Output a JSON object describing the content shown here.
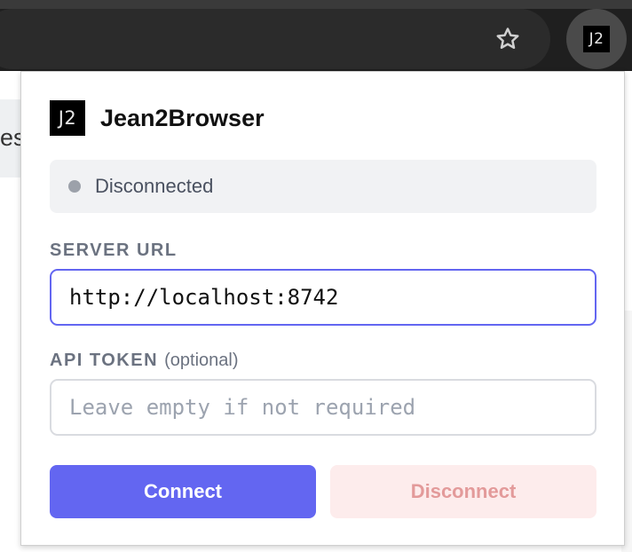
{
  "browser": {
    "star_icon": "star-outline-icon",
    "extension_badge": "J2"
  },
  "page_behind": {
    "left_text": "es"
  },
  "popup": {
    "logo_text": "J2",
    "title": "Jean2Browser",
    "status": {
      "text": "Disconnected",
      "dot_color": "#9ca1aa"
    },
    "server_url": {
      "label": "SERVER URL",
      "value": "http://localhost:8742"
    },
    "api_token": {
      "label": "API TOKEN",
      "label_note": "(optional)",
      "value": "",
      "placeholder": "Leave empty if not required"
    },
    "buttons": {
      "connect": "Connect",
      "disconnect": "Disconnect"
    },
    "colors": {
      "accent": "#6366f1",
      "disconnect_bg": "#fdecec",
      "disconnect_text": "#e39a9a"
    }
  }
}
